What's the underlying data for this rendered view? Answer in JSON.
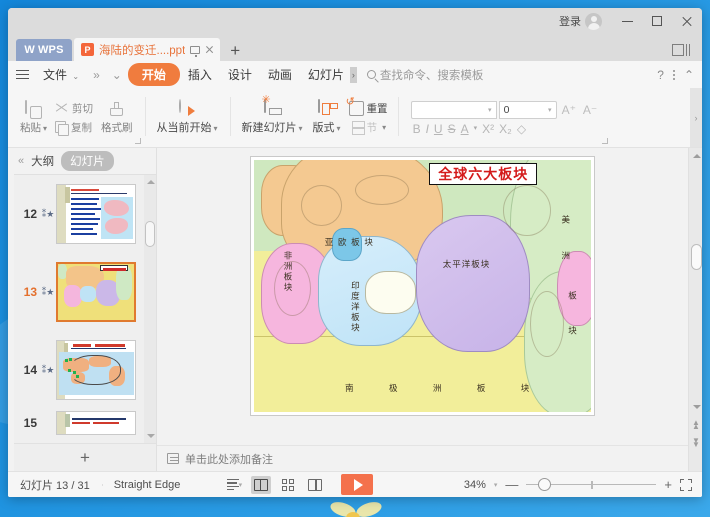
{
  "titlebar": {
    "login_label": "登录",
    "avatar_icon": "user-avatar-icon",
    "minimize_icon": "minimize-icon",
    "maximize_icon": "maximize-icon",
    "close_icon": "close-icon"
  },
  "tabstrip": {
    "brand_label": "WPS",
    "brand_logo_icon": "wps-logo-icon",
    "document_tab": {
      "title": "海陆的变迁....ppt",
      "type_icon": "powerpoint-file-icon",
      "present_icon": "monitor-icon",
      "close_icon": "close-tab-icon"
    },
    "new_tab_label": "+",
    "panel_toggle_icon": "split-panel-icon"
  },
  "menubar": {
    "menu_icon": "hamburger-icon",
    "file_label": "文件",
    "file_caret": "⌄",
    "overflow_left_icon": "chevron-double-right-icon",
    "quickaccess_caret_icon": "chevron-down-icon",
    "tabs": [
      {
        "label": "开始",
        "active": true
      },
      {
        "label": "插入",
        "active": false
      },
      {
        "label": "设计",
        "active": false
      },
      {
        "label": "动画",
        "active": false
      },
      {
        "label": "幻灯片",
        "active": false
      }
    ],
    "tab_overflow": "›",
    "search_placeholder": "查找命令、搜索模板",
    "search_icon": "search-icon",
    "help_label": "?",
    "more_icon": "kebab-menu-icon",
    "collapse_ribbon_icon": "chevron-up-icon"
  },
  "ribbon": {
    "clipboard": {
      "paste_label": "粘贴",
      "paste_icon": "clipboard-icon",
      "cut_label": "剪切",
      "cut_icon": "scissors-icon",
      "copy_label": "复制",
      "copy_icon": "copy-icon",
      "format_painter_label": "格式刷",
      "format_painter_icon": "format-painter-icon"
    },
    "present": {
      "from_current_label": "从当前开始",
      "play_icon": "play-circle-icon",
      "caret": "▾"
    },
    "slides": {
      "new_slide_label": "新建幻灯片",
      "new_slide_icon": "new-slide-icon",
      "layout_label": "版式",
      "layout_icon": "slide-layout-icon",
      "reset_label": "重置",
      "reset_icon": "reset-icon",
      "section_label": "节",
      "section_icon": "section-icon",
      "caret": "▾"
    },
    "font": {
      "font_name_value": "",
      "font_size_value": "0",
      "grow_font_icon": "increase-font-icon",
      "shrink_font_icon": "decrease-font-icon",
      "bold_label": "B",
      "italic_label": "I",
      "underline_label": "U",
      "strikethrough_label": "S",
      "text_color_label": "A",
      "superscript_label": "X²",
      "subscript_label": "X₂",
      "clear_format_icon": "eraser-icon",
      "caret": "▾"
    },
    "side_expand_icon": "chevron-right-icon"
  },
  "slidepanel": {
    "collapse_icon": "collapse-left-icon",
    "tabs": [
      {
        "label": "大纲",
        "active": false
      },
      {
        "label": "幻灯片",
        "active": true
      }
    ],
    "thumbnails": [
      {
        "number": "12",
        "selected": false,
        "star_icon": "animation-star-icon"
      },
      {
        "number": "13",
        "selected": true,
        "star_icon": "animation-star-icon"
      },
      {
        "number": "14",
        "selected": false,
        "star_icon": "animation-star-icon"
      },
      {
        "number": "15",
        "selected": false,
        "star_icon": "animation-star-icon"
      }
    ],
    "add_slide_label": "+",
    "scroll_up_icon": "scroll-up-icon",
    "scroll_down_icon": "scroll-down-icon"
  },
  "slide": {
    "title": "全球六大板块",
    "title_color": "#d41b1b",
    "plates": [
      {
        "key": "eurasia",
        "label": "亚 欧 板 块",
        "color": "#f4c991"
      },
      {
        "key": "pacific",
        "label": "太平洋板块",
        "color": "#cbb8e8"
      },
      {
        "key": "africa",
        "label": "非洲板块",
        "color": "#f6b6de"
      },
      {
        "key": "indian",
        "label": "印度洋板块",
        "color": "#bfe3f7"
      },
      {
        "key": "antarctic",
        "label": "南 极 洲 板 块",
        "color": "#f2ee9a"
      },
      {
        "key": "america",
        "label": "美洲板块",
        "color": "#d6ecc5"
      }
    ],
    "label_america_top": "美",
    "label_america_mid": "洲",
    "label_america_b1": "板",
    "label_america_b2": "块",
    "label_eurasia": "亚 欧 板 块",
    "label_pacific": "太平洋板块",
    "label_africa": "非洲板块",
    "label_indian": "印度洋板块",
    "label_antarctic_1": "南",
    "label_antarctic_2": "极",
    "label_antarctic_3": "洲",
    "label_antarctic_4": "板",
    "label_antarctic_5": "块"
  },
  "notes": {
    "icon": "notes-icon",
    "placeholder": "单击此处添加备注"
  },
  "scrollbar": {
    "up_icon": "scroll-up-icon",
    "down_icon": "scroll-down-icon",
    "prev_slide_icon": "previous-slide-icon",
    "next_slide_icon": "next-slide-icon"
  },
  "statusbar": {
    "slide_count_label": "幻灯片 13 / 31",
    "template_label": "Straight Edge",
    "views": [
      {
        "name": "outline-view",
        "icon": "lines-icon",
        "active": false
      },
      {
        "name": "normal-view",
        "icon": "normal-view-icon",
        "active": true
      },
      {
        "name": "slide-sorter-view",
        "icon": "grid-view-icon",
        "active": false
      },
      {
        "name": "reading-view",
        "icon": "book-view-icon",
        "active": false
      }
    ],
    "play_icon": "play-slideshow-icon",
    "zoom_value": "34%",
    "zoom_caret": "▾",
    "zoom_out_label": "—",
    "zoom_in_label": "+",
    "fit_icon": "fit-to-window-icon"
  },
  "colors": {
    "accent_orange": "#f07c3e",
    "tab_title": "#e8743c",
    "desktop_blue": "#1f93e0",
    "selected_slide_border": "#e07a2f"
  }
}
